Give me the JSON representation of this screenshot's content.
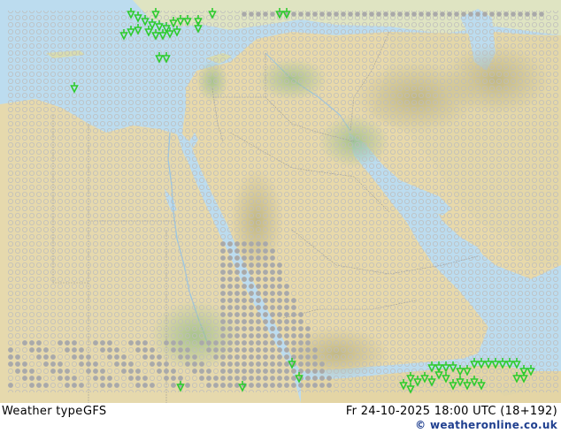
{
  "map": {
    "region": "Eastern Mediterranean, Red Sea and Arabian Peninsula",
    "land_color": "#e9dcb3",
    "desert_color": "#e2d2a2",
    "highland_color": "#c9c08f",
    "vegetation_color": "#a9c693",
    "sea_color": "#bcdcef",
    "lake_color": "#bcdcef",
    "symbol_colors": {
      "no_precip": "#bdbdbd",
      "drizzle": "#a9a9a9",
      "rain_showers": "#2ecc2e"
    }
  },
  "footer": {
    "product": "Weather type",
    "model": "GFS",
    "valid_time": "Fr 24-10-2025 18:00 UTC (18+192)",
    "credit": "weatheronline.co.uk",
    "credit_symbol": "©"
  }
}
